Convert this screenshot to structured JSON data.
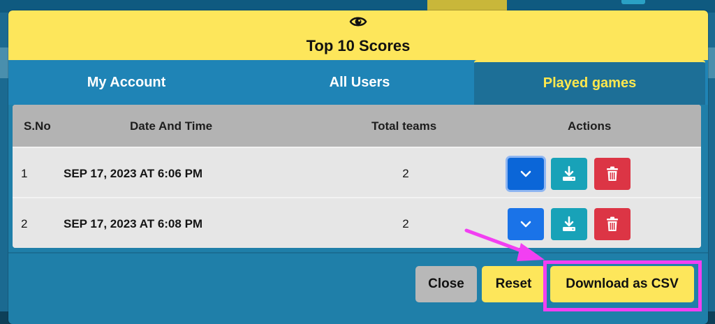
{
  "modal": {
    "title": "Top 10 Scores"
  },
  "tabs": [
    {
      "label": "My Account",
      "active": false
    },
    {
      "label": "All Users",
      "active": false
    },
    {
      "label": "Played games",
      "active": true
    }
  ],
  "table": {
    "headers": [
      "S.No",
      "Date And Time",
      "Total teams",
      "Actions"
    ],
    "rows": [
      {
        "sno": "1",
        "datetime": "SEP 17, 2023 AT 6:06 PM",
        "total_teams": "2"
      },
      {
        "sno": "2",
        "datetime": "SEP 17, 2023 AT 6:08 PM",
        "total_teams": "2"
      }
    ]
  },
  "footer": {
    "close_label": "Close",
    "reset_label": "Reset",
    "download_csv_label": "Download as CSV"
  },
  "icons": {
    "header": "eye-icon",
    "expand": "chevron-down-icon",
    "download": "download-icon",
    "delete": "trash-icon"
  },
  "colors": {
    "header_bg": "#fde65b",
    "modal_bg": "#1f7fa9",
    "active_tab_text": "#ffe84d",
    "expand_button": "#1a73e8",
    "download_button": "#18a2b8",
    "delete_button": "#dc3545",
    "highlight": "#f23ff2"
  }
}
